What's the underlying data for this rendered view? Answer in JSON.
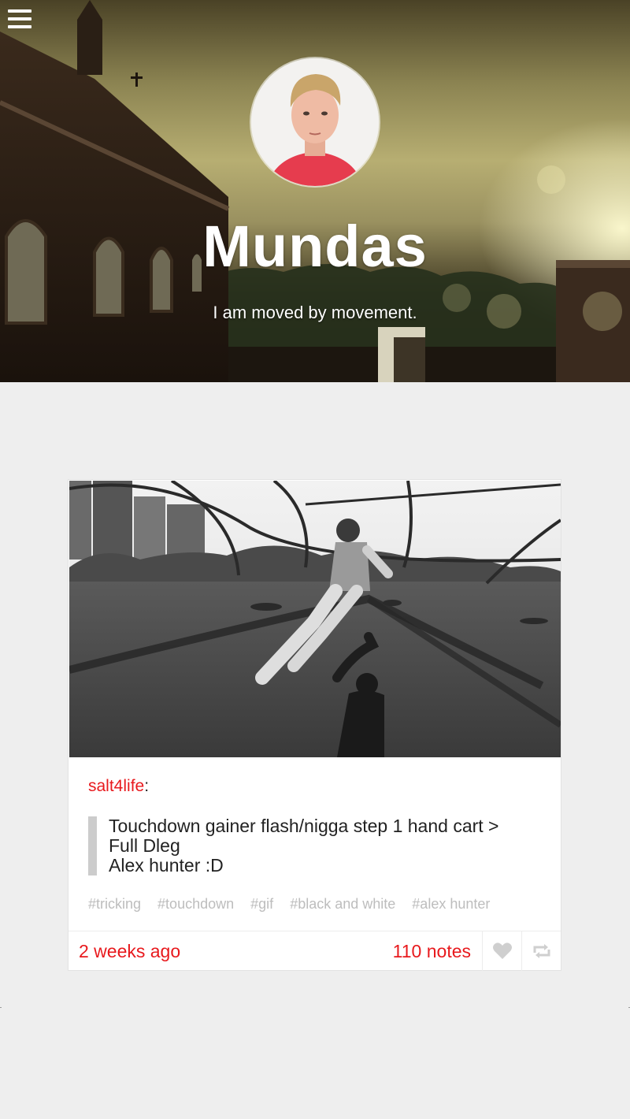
{
  "header": {
    "blog_title": "Mundas",
    "description": "I am moved by movement."
  },
  "post": {
    "author": "salt4life",
    "quote_lines": [
      "Touchdown gainer flash/nigga step 1 hand cart >",
      "Full Dleg",
      "Alex hunter :D"
    ],
    "tags": [
      "#tricking",
      "#touchdown",
      "#gif",
      "#black and white",
      "#alex hunter"
    ],
    "date": "2 weeks ago",
    "notes": "110 notes"
  },
  "icons": {
    "menu": "hamburger-menu-icon",
    "like": "heart-icon",
    "reblog": "reblog-icon"
  },
  "colors": {
    "accent": "#e8191d",
    "page_bg": "#eeeeee",
    "tag_gray": "#bdbdbd",
    "quote_bar": "#cccccc"
  }
}
